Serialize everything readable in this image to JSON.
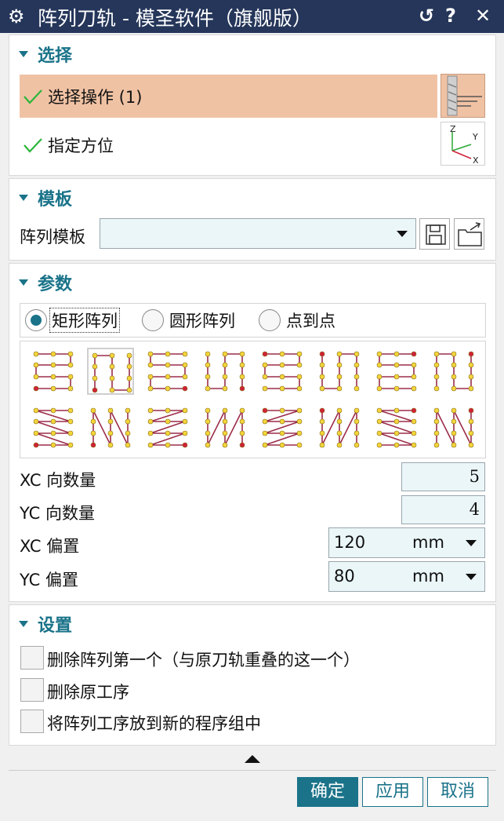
{
  "window": {
    "title": "阵列刀轨 - 模圣软件（旗舰版）",
    "reset_glyph": "↺",
    "help_glyph": "?",
    "close_glyph": "✕"
  },
  "select_section": {
    "header": "选择",
    "select_operation": "选择操作 (1)",
    "specify_orientation": "指定方位",
    "highlight_color": "#f0c2a4",
    "axis_labels": {
      "z": "Z",
      "y": "Y",
      "x": "X"
    }
  },
  "template_section": {
    "header": "模板",
    "array_template_label": "阵列模板",
    "array_template_value": ""
  },
  "params_section": {
    "header": "参数",
    "radio_options": [
      "矩形阵列",
      "圆形阵列",
      "点到点"
    ],
    "selected_radio": 0,
    "xc_count_label": "XC 向数量",
    "xc_count_value": "5",
    "yc_count_label": "YC 向数量",
    "yc_count_value": "4",
    "xc_offset_label": "XC 偏置",
    "xc_offset_value": "120",
    "xc_offset_unit": "mm",
    "yc_offset_label": "YC 偏置",
    "yc_offset_value": "80",
    "yc_offset_unit": "mm",
    "selected_pattern": 1
  },
  "settings_section": {
    "header": "设置",
    "options": [
      "删除阵列第一个（与原刀轨重叠的这一个）",
      "删除原工序",
      "将阵列工序放到新的程序组中"
    ],
    "checked": [
      false,
      false,
      false
    ]
  },
  "footer": {
    "ok": "确定",
    "apply": "应用",
    "cancel": "取消"
  },
  "colors": {
    "accent": "#1a7389",
    "title_bar": "#25365a",
    "path_line": "#9b2d4a",
    "point_fill": "#f3d53c",
    "start_point": "#d0213a"
  }
}
